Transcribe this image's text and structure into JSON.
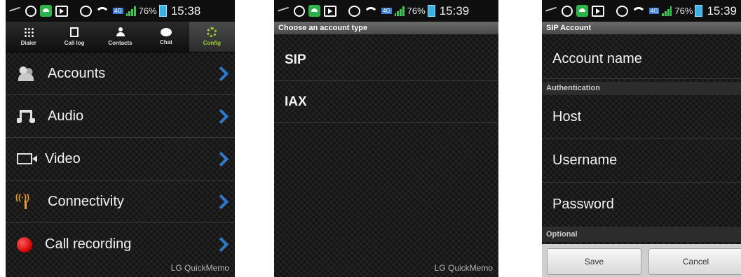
{
  "status_bars": [
    {
      "battery": "76%",
      "time": "15:38"
    },
    {
      "battery": "76%",
      "time": "15:39"
    },
    {
      "battery": "76%",
      "time": "15:39"
    }
  ],
  "screen1": {
    "tabs": [
      {
        "label": "Dialer",
        "icon": "dialer-icon"
      },
      {
        "label": "Call log",
        "icon": "call-log-icon"
      },
      {
        "label": "Contacts",
        "icon": "contacts-icon"
      },
      {
        "label": "Chat",
        "icon": "chat-icon"
      },
      {
        "label": "Config",
        "icon": "config-gear-icon",
        "active": true
      }
    ],
    "menu": [
      {
        "label": "Accounts",
        "icon": "accounts-icon"
      },
      {
        "label": "Audio",
        "icon": "audio-icon"
      },
      {
        "label": "Video",
        "icon": "video-camera-icon"
      },
      {
        "label": "Connectivity",
        "icon": "antenna-icon"
      },
      {
        "label": "Call recording",
        "icon": "record-icon"
      }
    ],
    "watermark": "LG QuickMemo"
  },
  "screen2": {
    "title": "Choose an account type",
    "options": [
      "SIP",
      "IAX"
    ],
    "watermark": "LG QuickMemo"
  },
  "screen3": {
    "title": "SIP Account",
    "account_name_label": "Account name",
    "auth_section": "Authentication",
    "host_label": "Host",
    "username_label": "Username",
    "password_label": "Password",
    "optional_section": "Optional",
    "save_label": "Save",
    "cancel_label": "Cancel"
  },
  "colors": {
    "accent_green": "#9ccf2c",
    "chevron_blue": "#2f79c9",
    "record_red": "#e01010"
  }
}
